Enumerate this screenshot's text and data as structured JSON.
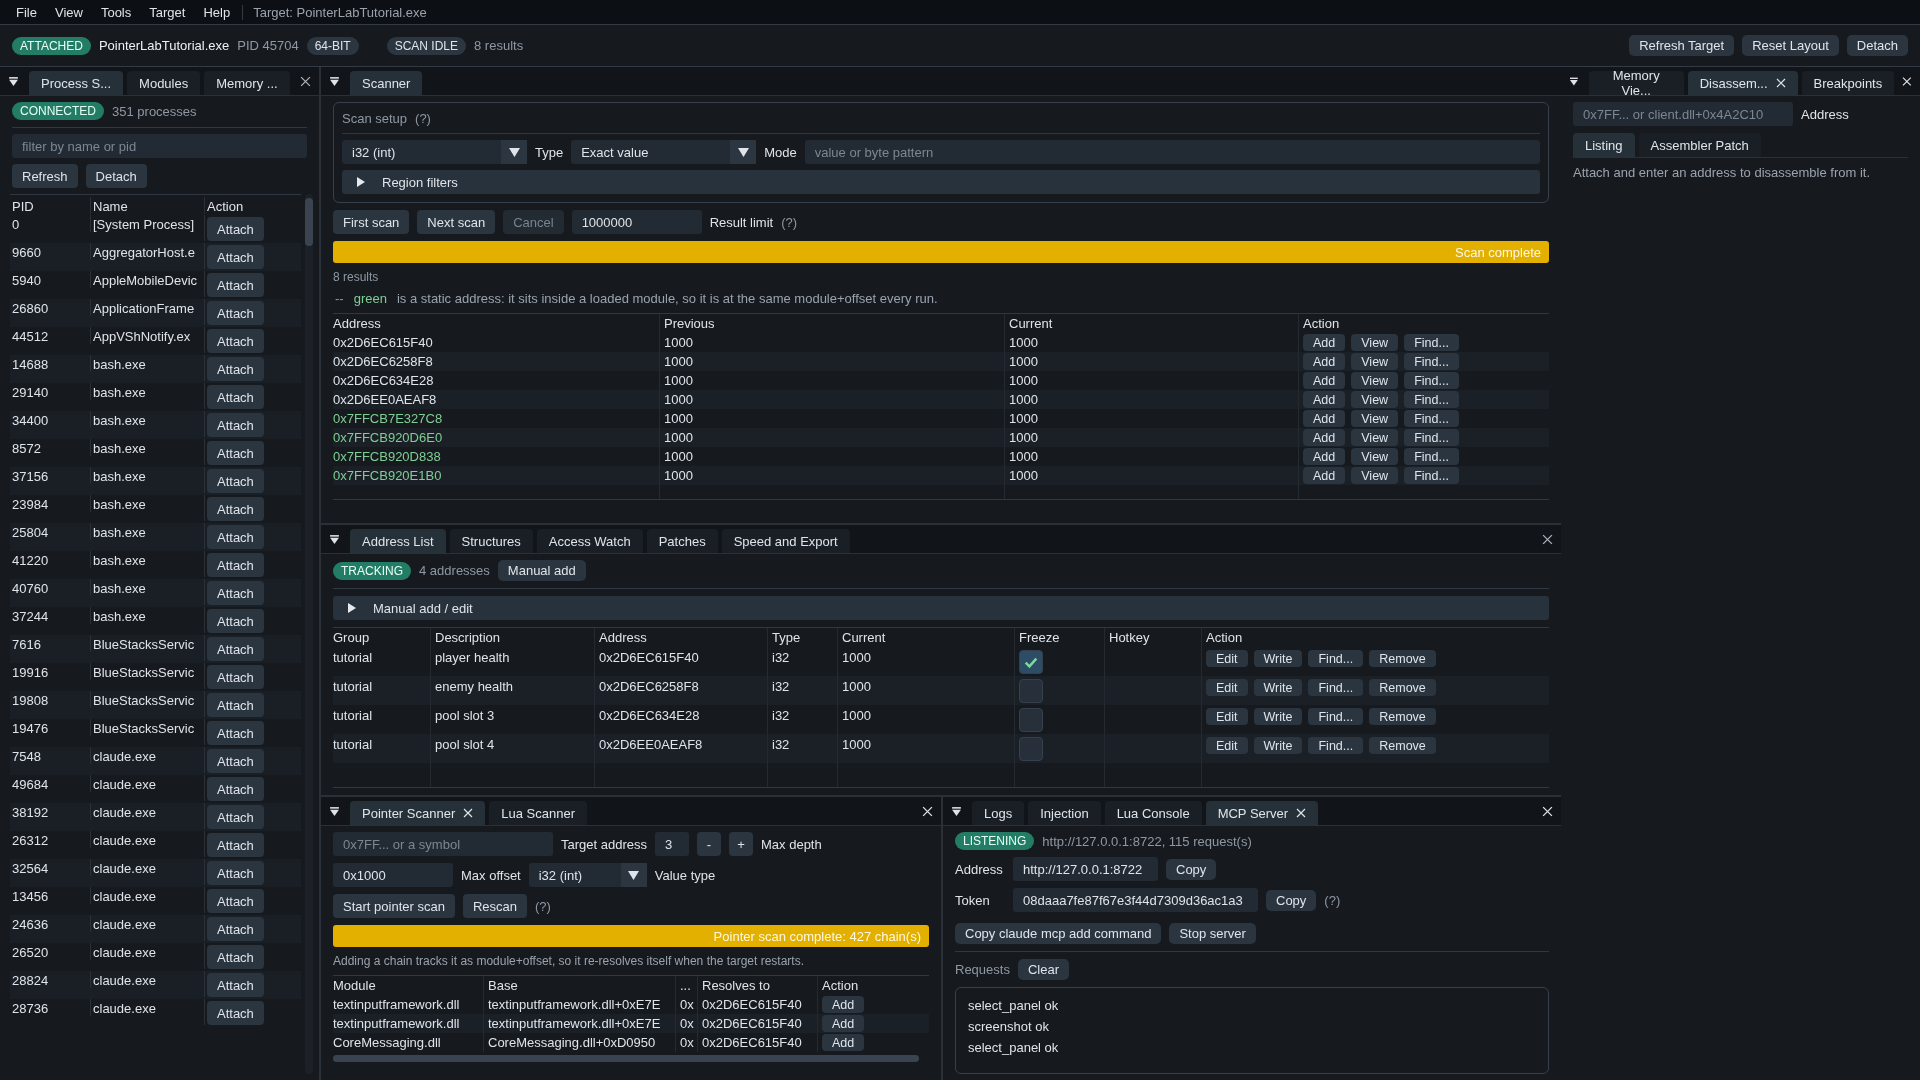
{
  "menu": [
    "File",
    "View",
    "Tools",
    "Target",
    "Help"
  ],
  "menu_target": "Target: PointerLabTutorial.exe",
  "top_bar": {
    "status": "ATTACHED",
    "process": "PointerLabTutorial.exe",
    "pid": "PID 45704",
    "arch": "64-BIT",
    "scan_state": "SCAN IDLE",
    "results": "8 results",
    "buttons": [
      "Refresh Target",
      "Reset Layout",
      "Detach"
    ]
  },
  "left_panel": {
    "tabs": [
      {
        "label": "Process S...",
        "selected": true
      },
      {
        "label": "Modules",
        "selected": false
      },
      {
        "label": "Memory ...",
        "selected": false
      }
    ],
    "status": "CONNECTED",
    "count": "351 processes",
    "filter_placeholder": "filter by name or pid",
    "buttons": [
      "Refresh",
      "Detach"
    ],
    "columns": [
      "PID",
      "Name",
      "Action"
    ],
    "rows": [
      {
        "pid": "0",
        "name": "[System Process]",
        "action": "Attach"
      },
      {
        "pid": "9660",
        "name": "AggregatorHost.e",
        "action": "Attach"
      },
      {
        "pid": "5940",
        "name": "AppleMobileDevic",
        "action": "Attach"
      },
      {
        "pid": "26860",
        "name": "ApplicationFrame",
        "action": "Attach"
      },
      {
        "pid": "44512",
        "name": "AppVShNotify.ex",
        "action": "Attach"
      },
      {
        "pid": "14688",
        "name": "bash.exe",
        "action": "Attach"
      },
      {
        "pid": "29140",
        "name": "bash.exe",
        "action": "Attach"
      },
      {
        "pid": "34400",
        "name": "bash.exe",
        "action": "Attach"
      },
      {
        "pid": "8572",
        "name": "bash.exe",
        "action": "Attach"
      },
      {
        "pid": "37156",
        "name": "bash.exe",
        "action": "Attach"
      },
      {
        "pid": "23984",
        "name": "bash.exe",
        "action": "Attach"
      },
      {
        "pid": "25804",
        "name": "bash.exe",
        "action": "Attach"
      },
      {
        "pid": "41220",
        "name": "bash.exe",
        "action": "Attach"
      },
      {
        "pid": "40760",
        "name": "bash.exe",
        "action": "Attach"
      },
      {
        "pid": "37244",
        "name": "bash.exe",
        "action": "Attach"
      },
      {
        "pid": "7616",
        "name": "BlueStacksServic",
        "action": "Attach"
      },
      {
        "pid": "19916",
        "name": "BlueStacksServic",
        "action": "Attach"
      },
      {
        "pid": "19808",
        "name": "BlueStacksServic",
        "action": "Attach"
      },
      {
        "pid": "19476",
        "name": "BlueStacksServic",
        "action": "Attach"
      },
      {
        "pid": "7548",
        "name": "claude.exe",
        "action": "Attach"
      },
      {
        "pid": "49684",
        "name": "claude.exe",
        "action": "Attach"
      },
      {
        "pid": "38192",
        "name": "claude.exe",
        "action": "Attach"
      },
      {
        "pid": "26312",
        "name": "claude.exe",
        "action": "Attach"
      },
      {
        "pid": "32564",
        "name": "claude.exe",
        "action": "Attach"
      },
      {
        "pid": "13456",
        "name": "claude.exe",
        "action": "Attach"
      },
      {
        "pid": "24636",
        "name": "claude.exe",
        "action": "Attach"
      },
      {
        "pid": "26520",
        "name": "claude.exe",
        "action": "Attach"
      },
      {
        "pid": "28824",
        "name": "claude.exe",
        "action": "Attach"
      },
      {
        "pid": "28736",
        "name": "claude.exe",
        "action": "Attach"
      }
    ]
  },
  "scanner": {
    "tab": "Scanner",
    "setup_title": "Scan setup",
    "setup_help": "(?)",
    "value_type": "i32 (int)",
    "type_label": "Type",
    "mode_select": "Exact value",
    "mode_label": "Mode",
    "value_placeholder": "value or byte pattern",
    "region_filters": {
      "label": "Region filters",
      "expanded": false
    },
    "buttons": [
      {
        "label": "First scan",
        "disabled": false
      },
      {
        "label": "Next scan",
        "disabled": false
      },
      {
        "label": "Cancel",
        "disabled": true
      }
    ],
    "limit_value": "1000000",
    "limit_label": "Result limit",
    "limit_help": "(?)",
    "progress": {
      "level": 1,
      "label": "Scan complete"
    },
    "result_count": "8 results",
    "legend": {
      "dash": "--",
      "word": "green",
      "text": "is a static address: it sits inside a loaded module, so it is at the same module+offset every run."
    },
    "columns": [
      "Address",
      "Previous",
      "Current",
      "Action"
    ],
    "rows": [
      {
        "address": "0x2D6EC615F40",
        "previous": "1000",
        "current": "1000",
        "static": false,
        "actions": [
          "Add",
          "View",
          "Find..."
        ]
      },
      {
        "address": "0x2D6EC6258F8",
        "previous": "1000",
        "current": "1000",
        "static": false,
        "actions": [
          "Add",
          "View",
          "Find..."
        ]
      },
      {
        "address": "0x2D6EC634E28",
        "previous": "1000",
        "current": "1000",
        "static": false,
        "actions": [
          "Add",
          "View",
          "Find..."
        ]
      },
      {
        "address": "0x2D6EE0AEAF8",
        "previous": "1000",
        "current": "1000",
        "static": false,
        "actions": [
          "Add",
          "View",
          "Find..."
        ]
      },
      {
        "address": "0x7FFCB7E327C8",
        "previous": "1000",
        "current": "1000",
        "static": true,
        "actions": [
          "Add",
          "View",
          "Find..."
        ]
      },
      {
        "address": "0x7FFCB920D6E0",
        "previous": "1000",
        "current": "1000",
        "static": true,
        "actions": [
          "Add",
          "View",
          "Find..."
        ]
      },
      {
        "address": "0x7FFCB920D838",
        "previous": "1000",
        "current": "1000",
        "static": true,
        "actions": [
          "Add",
          "View",
          "Find..."
        ]
      },
      {
        "address": "0x7FFCB920E1B0",
        "previous": "1000",
        "current": "1000",
        "static": true,
        "actions": [
          "Add",
          "View",
          "Find..."
        ]
      }
    ]
  },
  "address_list": {
    "tabs": [
      {
        "label": "Address List",
        "selected": true
      },
      {
        "label": "Structures",
        "selected": false
      },
      {
        "label": "Access Watch",
        "selected": false
      },
      {
        "label": "Patches",
        "selected": false
      },
      {
        "label": "Speed and Export",
        "selected": false
      }
    ],
    "status": "TRACKING",
    "count": "4 addresses",
    "manual_button": "Manual add",
    "manual_section": {
      "label": "Manual add / edit",
      "expanded": false
    },
    "columns": [
      "Group",
      "Description",
      "Address",
      "Type",
      "Current",
      "Freeze",
      "Hotkey",
      "Action"
    ],
    "rows": [
      {
        "group": "tutorial",
        "description": "player health",
        "address": "0x2D6EC615F40",
        "type": "i32",
        "current": "1000",
        "frozen": true,
        "actions": [
          "Edit",
          "Write",
          "Find...",
          "Remove"
        ]
      },
      {
        "group": "tutorial",
        "description": "enemy health",
        "address": "0x2D6EC6258F8",
        "type": "i32",
        "current": "1000",
        "frozen": false,
        "actions": [
          "Edit",
          "Write",
          "Find...",
          "Remove"
        ]
      },
      {
        "group": "tutorial",
        "description": "pool slot 3",
        "address": "0x2D6EC634E28",
        "type": "i32",
        "current": "1000",
        "frozen": false,
        "actions": [
          "Edit",
          "Write",
          "Find...",
          "Remove"
        ]
      },
      {
        "group": "tutorial",
        "description": "pool slot 4",
        "address": "0x2D6EE0AEAF8",
        "type": "i32",
        "current": "1000",
        "frozen": false,
        "actions": [
          "Edit",
          "Write",
          "Find...",
          "Remove"
        ]
      }
    ]
  },
  "pointer_panel": {
    "tabs": [
      {
        "label": "Pointer Scanner",
        "selected": true,
        "closable": true
      },
      {
        "label": "Lua Scanner",
        "selected": false,
        "closable": false
      }
    ],
    "target_placeholder": "0x7FF... or a symbol",
    "target_label": "Target address",
    "depth_value": "3",
    "minus": "-",
    "plus": "+",
    "depth_label": "Max depth",
    "offset_value": "0x1000",
    "offset_label": "Max offset",
    "value_type": "i32 (int)",
    "value_type_label": "Value type",
    "buttons": [
      "Start pointer scan",
      "Rescan"
    ],
    "help": "(?)",
    "progress": {
      "level": 1,
      "label": "Pointer scan complete: 427 chain(s)"
    },
    "note": "Adding a chain tracks it as module+offset, so it re-resolves itself when the target restarts.",
    "columns": [
      "Module",
      "Base",
      "...",
      "Resolves to",
      "Action"
    ],
    "rows": [
      {
        "module": "textinputframework.dll",
        "base": "textinputframework.dll+0xE7E",
        "column_3": "0x",
        "resolves_to": "0x2D6EC615F40",
        "action": "Add"
      },
      {
        "module": "textinputframework.dll",
        "base": "textinputframework.dll+0xE7E",
        "column_3": "0x",
        "resolves_to": "0x2D6EC615F40",
        "action": "Add"
      },
      {
        "module": "CoreMessaging.dll",
        "base": "CoreMessaging.dll+0xD0950",
        "column_3": "0x",
        "resolves_to": "0x2D6EC615F40",
        "action": "Add"
      }
    ]
  },
  "server_panel": {
    "tabs": [
      {
        "label": "Logs",
        "selected": false,
        "closable": false
      },
      {
        "label": "Injection",
        "selected": false,
        "closable": false
      },
      {
        "label": "Lua Console",
        "selected": false,
        "closable": false
      },
      {
        "label": "MCP Server",
        "selected": true,
        "closable": true
      }
    ],
    "status": "LISTENING",
    "status_text": "http://127.0.0.1:8722, 115 request(s)",
    "address_label": "Address",
    "address_value": "http://127.0.0.1:8722",
    "token_label": "Token",
    "token_value": "08daaa7fe87f67e3f44d7309d36ac1a3",
    "address_copy": "Copy",
    "token_copy": "Copy",
    "help": "(?)",
    "buttons": [
      "Copy claude mcp add command",
      "Stop server"
    ],
    "requests_label": "Requests",
    "clear": "Clear",
    "requests": [
      "select_panel ok",
      "screenshot ok",
      "select_panel ok"
    ]
  },
  "right_panel": {
    "tabs": [
      {
        "label": "Memory Vie...",
        "selected": false,
        "closable": false
      },
      {
        "label": "Disassem...",
        "selected": true,
        "closable": true
      },
      {
        "label": "Breakpoints",
        "selected": false,
        "closable": false
      }
    ],
    "address_placeholder": "0x7FF... or client.dll+0x4A2C10",
    "address_label": "Address",
    "subtabs": [
      {
        "label": "Listing",
        "selected": true
      },
      {
        "label": "Assembler Patch",
        "selected": false
      }
    ],
    "message": "Attach and enter an address to disassemble from it."
  }
}
